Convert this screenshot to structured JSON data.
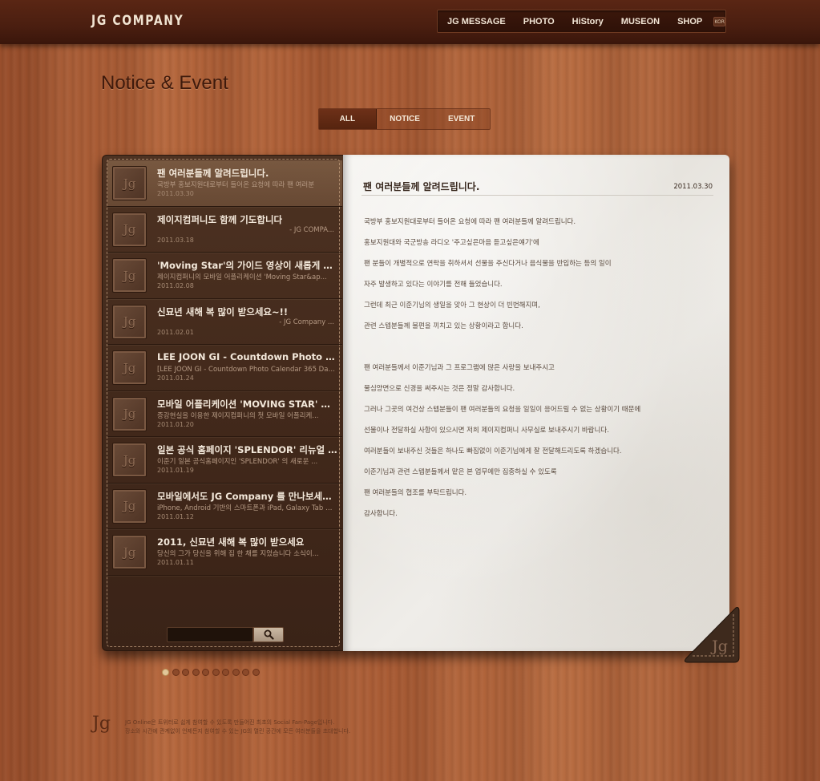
{
  "header": {
    "logo": "JG COMPANY",
    "nav": [
      "JG MESSAGE",
      "PHOTO",
      "HiStory",
      "MUSEON",
      "SHOP"
    ],
    "lang": "KOR"
  },
  "page_title": "Notice & Event",
  "tabs": [
    "ALL",
    "NOTICE",
    "EVENT"
  ],
  "list": [
    {
      "title": "팬 여러분들께 알려드립니다.",
      "sub": "국방부 홍보지원대로부터 들어온 요청에 따라 팬 여러분",
      "date": "2011.03.30",
      "sub_align": "left"
    },
    {
      "title": "제이지컴퍼니도 함께 기도합니다",
      "sub": "- JG COMPA...",
      "date": "2011.03.18",
      "sub_align": "right"
    },
    {
      "title": "'Moving Star'의 가이드 영상이 새롭게 업데이...",
      "sub": "제이지컴퍼니의 모바일 어플리케이션 'Moving Star&ap...",
      "date": "2011.02.08",
      "sub_align": "left"
    },
    {
      "title": "신묘년 새해 복 많이 받으세요~!!",
      "sub": "- JG Company ...",
      "date": "2011.02.01",
      "sub_align": "right"
    },
    {
      "title": "LEE JOON GI - Countdown Photo Calenda...",
      "sub": "[LEE JOON GI - Countdown Photo Calendar 365 Days 판...",
      "date": "2011.01.24",
      "sub_align": "left"
    },
    {
      "title": "모바일 어플리케이션 'MOVING STAR' 오픈",
      "sub": "증강현실을 이용한 제이지컴퍼니의 첫 모바일 어플리케...",
      "date": "2011.01.20",
      "sub_align": "left"
    },
    {
      "title": "일본 공식 홈페이지 'SPLENDOR' 리뉴얼 오픈!...",
      "sub": "이준기 일본 공식홈페이지인 'SPLENDOR' 의 새로운 ...",
      "date": "2011.01.19",
      "sub_align": "left"
    },
    {
      "title": "모바일에서도 JG Company 를 만나보세요!!",
      "sub": "iPhone, Android 기반의 스마트폰과 iPad, Galaxy Tab 에...",
      "date": "2011.01.12",
      "sub_align": "left"
    },
    {
      "title": "2011, 신묘년 새해 복 많이 받으세요",
      "sub": "당신의 그가 당신을 위해 집 한 채를 지었습니다 소식이...",
      "date": "2011.01.11",
      "sub_align": "left"
    }
  ],
  "thumb_label": "Jg",
  "search": {
    "placeholder": ""
  },
  "post": {
    "title": "팬 여러분들께 알려드립니다.",
    "date": "2011.03.30",
    "paragraphs": [
      "국방부 홍보지원대로부터 들어온 요청에 따라 팬 여러분들께 알려드립니다.",
      "홍보지원대와 국군방송 라디오 '주고싶은마음 듣고싶은얘기'에",
      "팬 분들이 개별적으로 연락을 취하셔서 선물을 주신다거나 음식물을 반입하는 등의 일이",
      "자주 발생하고 있다는 이야기를 전해 들었습니다.",
      "그런데 최근 이준기님의 생일을 맞아 그 현상이 더 빈번해지며,",
      "관련 스텝분들께 불편을 끼치고 있는 상황이라고 합니다.",
      "",
      "팬 여러분들께서 이준기님과 그 프로그램에 많은 사랑을 보내주시고",
      "물심양면으로 신경을 써주시는 것은 정말 감사합니다.",
      "그러나 그곳의 여건상 스텝분들이 팬 여러분들의 요청을 일일이 응어드릴 수 없는 상황이기 때문에",
      "선물이나 전달하실 사항이 있으시면 저희 제이지컴퍼니 사무실로 보내주시기 바랍니다.",
      "여러분들이 보내주신 것들은 하나도 빠짐없이 이준기님에게 잘 전달해드리도록 하겠습니다.",
      "이준기님과 관련 스텝분들께서 맡은 본 업무에만 집중하실 수 있도록",
      "팬 여러분들의 협조를 부탁드립니다.",
      "감사합니다."
    ]
  },
  "corner_label": "Jg",
  "pagination": {
    "count": 10,
    "active": 0
  },
  "footer": {
    "logo": "Jg",
    "line1": "JG Online은 트위터로 쉽게 참여할 수 있도록 만들어진 최초의 Social Fan-Page입니다.",
    "line2": "장소와 시간에 관계없이 언제든지 참여할 수 있는 JG의 열린 공간에 모든 여러분들을 초대합니다."
  },
  "colors": {
    "accent": "#e2c79a",
    "header": "#4a1e10"
  }
}
